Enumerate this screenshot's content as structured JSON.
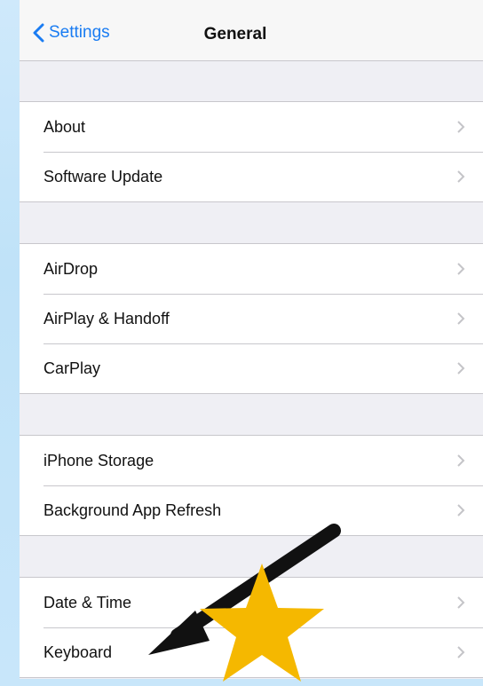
{
  "nav": {
    "back_label": "Settings",
    "title": "General"
  },
  "groups": [
    {
      "items": [
        {
          "label": "About"
        },
        {
          "label": "Software Update"
        }
      ]
    },
    {
      "items": [
        {
          "label": "AirDrop"
        },
        {
          "label": "AirPlay & Handoff"
        },
        {
          "label": "CarPlay"
        }
      ]
    },
    {
      "items": [
        {
          "label": "iPhone Storage"
        },
        {
          "label": "Background App Refresh"
        }
      ]
    },
    {
      "items": [
        {
          "label": "Date & Time"
        },
        {
          "label": "Keyboard"
        }
      ]
    }
  ],
  "annotations": {
    "arrow_color": "#111111",
    "star_color": "#f5b800"
  },
  "colors": {
    "accent": "#1a7cf2"
  }
}
